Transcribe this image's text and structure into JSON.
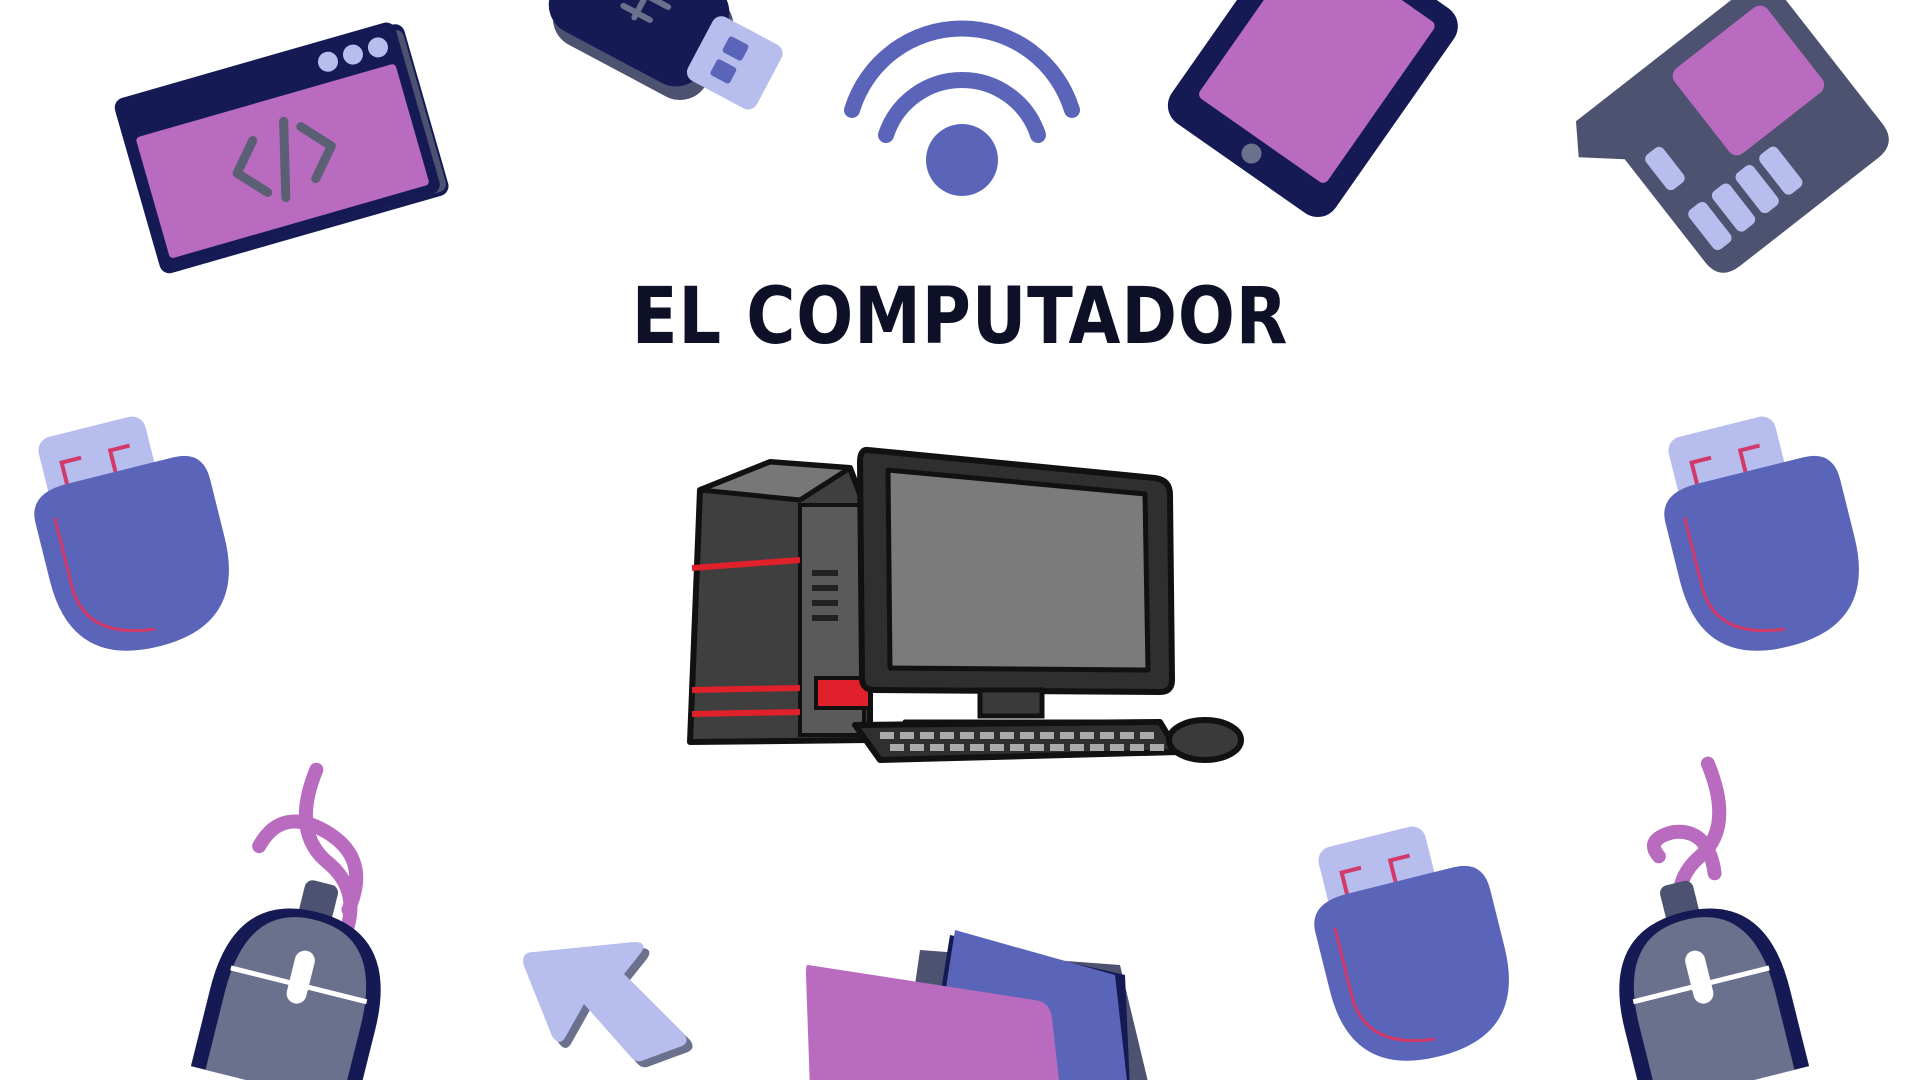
{
  "title": "EL COMPUTADOR",
  "colors": {
    "navy": "#151a55",
    "purple": "#b86bbf",
    "blue": "#5a64b8",
    "lavender": "#b7bdec",
    "slate": "#6b718d",
    "dark_slate": "#4c5270",
    "red": "#e0202a",
    "title": "#0e1028"
  },
  "icons": [
    "code-window-icon",
    "usb-drive-icon",
    "wifi-icon",
    "smartphone-icon",
    "sd-card-icon",
    "usb-plug-icon",
    "desktop-computer-icon",
    "mouse-icon",
    "cursor-arrow-icon",
    "folder-icon"
  ]
}
